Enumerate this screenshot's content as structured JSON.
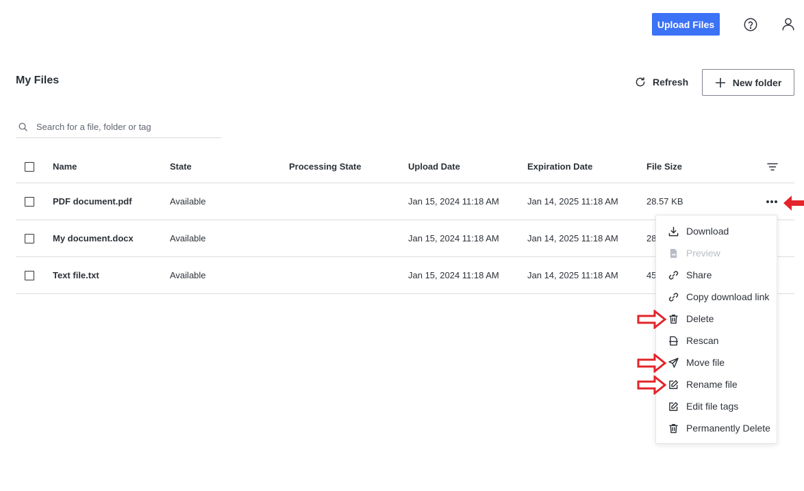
{
  "topbar": {
    "upload_label": "Upload Files",
    "help_icon": "help-circle-icon",
    "user_icon": "user-icon",
    "accent_color": "#3c72f5"
  },
  "header": {
    "title": "My Files",
    "refresh_label": "Refresh",
    "new_folder_label": "New folder"
  },
  "search": {
    "placeholder": "Search for a file, folder or tag"
  },
  "table": {
    "columns": {
      "name": "Name",
      "state": "State",
      "processing_state": "Processing State",
      "upload_date": "Upload Date",
      "expiration_date": "Expiration Date",
      "file_size": "File Size"
    },
    "rows": [
      {
        "name": "PDF document.pdf",
        "state": "Available",
        "processing_state": "",
        "upload_date": "Jan 15, 2024 11:18 AM",
        "expiration_date": "Jan 14, 2025 11:18 AM",
        "file_size": "28.57 KB"
      },
      {
        "name": "My document.docx",
        "state": "Available",
        "processing_state": "",
        "upload_date": "Jan 15, 2024 11:18 AM",
        "expiration_date": "Jan 14, 2025 11:18 AM",
        "file_size": "28"
      },
      {
        "name": "Text file.txt",
        "state": "Available",
        "processing_state": "",
        "upload_date": "Jan 15, 2024 11:18 AM",
        "expiration_date": "Jan 14, 2025 11:18 AM",
        "file_size": "45"
      }
    ]
  },
  "menu": {
    "items": [
      {
        "label": "Download",
        "icon": "download-icon",
        "disabled": false
      },
      {
        "label": "Preview",
        "icon": "file-preview-icon",
        "disabled": true
      },
      {
        "label": "Share",
        "icon": "link-icon",
        "disabled": false
      },
      {
        "label": "Copy download link",
        "icon": "link-icon",
        "disabled": false
      },
      {
        "label": "Delete",
        "icon": "trash-icon",
        "disabled": false
      },
      {
        "label": "Rescan",
        "icon": "rescan-icon",
        "disabled": false
      },
      {
        "label": "Move file",
        "icon": "send-icon",
        "disabled": false
      },
      {
        "label": "Rename file",
        "icon": "edit-icon",
        "disabled": false
      },
      {
        "label": "Edit file tags",
        "icon": "edit-icon",
        "disabled": false
      },
      {
        "label": "Permanently Delete",
        "icon": "trash-icon",
        "disabled": false
      }
    ]
  },
  "annotation": {
    "arrow_color": "#e3242b"
  }
}
